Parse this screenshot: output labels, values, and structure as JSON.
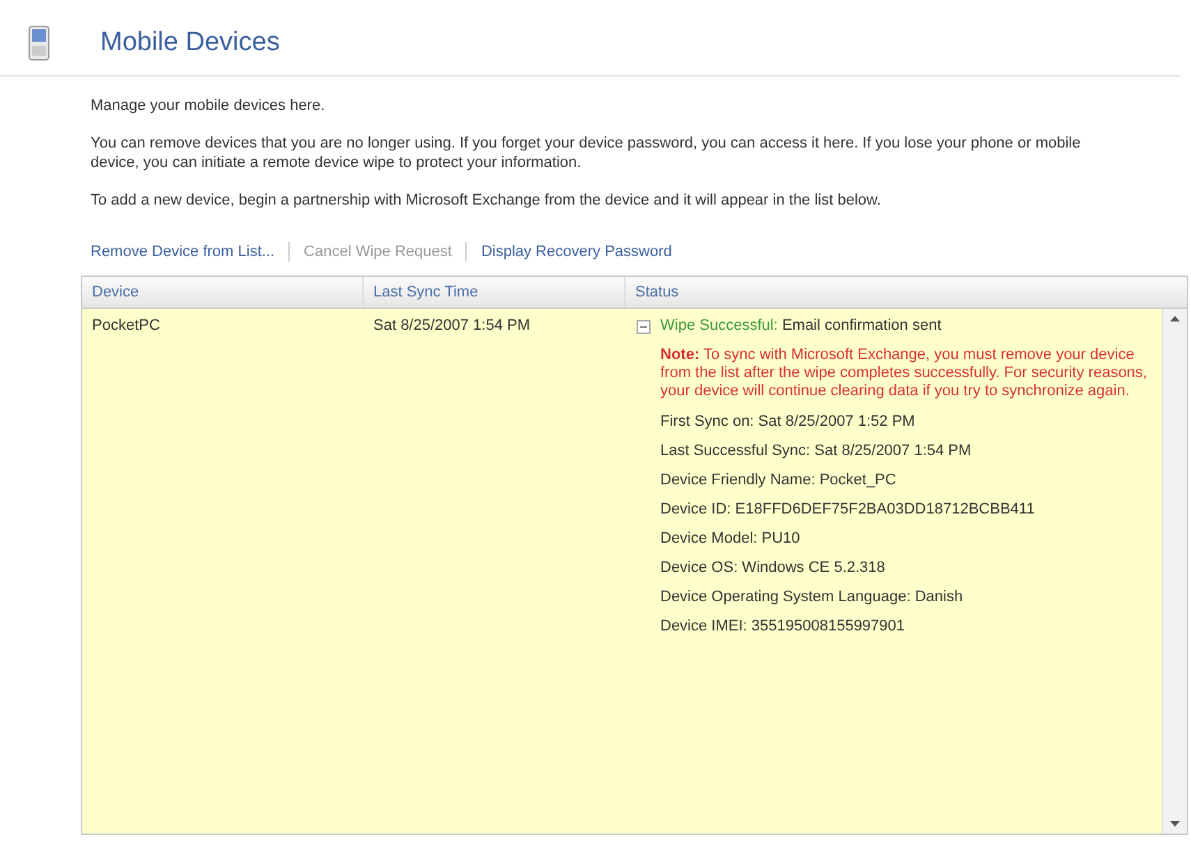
{
  "header": {
    "title": "Mobile Devices"
  },
  "intro": [
    "Manage your mobile devices here.",
    "You can remove devices that you are no longer using. If you forget your device password, you can access it here. If you lose your phone or mobile device, you can initiate a remote device wipe to protect your information.",
    "To add a new device, begin a partnership with Microsoft Exchange from the device and it will appear in the list below."
  ],
  "actions": [
    {
      "label": "Remove Device from List...",
      "disabled": false
    },
    {
      "label": "Cancel Wipe Request",
      "disabled": true
    },
    {
      "label": "Display Recovery Password",
      "disabled": false
    }
  ],
  "table": {
    "columns": [
      "Device",
      "Last Sync Time",
      "Status"
    ],
    "rows": [
      {
        "device": "PocketPC",
        "last_sync": "Sat 8/25/2007 1:54 PM",
        "selected": true,
        "expanded": true,
        "status": [
          {
            "kind": "status",
            "label": "Wipe Successful:",
            "text": "Email confirmation sent"
          },
          {
            "kind": "note",
            "text": "**Note:** To sync with Microsoft Exchange, you must remove your device from the list after the wipe completes successfully. For security reasons, your device will continue clearing data if you try to synchronize again."
          },
          {
            "kind": "detail",
            "text": "First Sync on: Sat 8/25/2007 1:52 PM"
          },
          {
            "kind": "detail",
            "text": "Last Successful Sync: Sat 8/25/2007 1:54 PM"
          },
          {
            "kind": "detail",
            "text": "Device Friendly Name: Pocket_PC"
          },
          {
            "kind": "detail",
            "text": "Device ID: E18FFD6DEF75F2BA03DD18712BCBB411"
          },
          {
            "kind": "detail",
            "text": "Device Model: PU10"
          },
          {
            "kind": "detail",
            "text": "Device OS: Windows CE 5.2.318"
          },
          {
            "kind": "detail",
            "text": "Device Operating System Language: Danish"
          },
          {
            "kind": "detail",
            "text": "Device IMEI: 355195008155997901"
          }
        ]
      }
    ]
  }
}
